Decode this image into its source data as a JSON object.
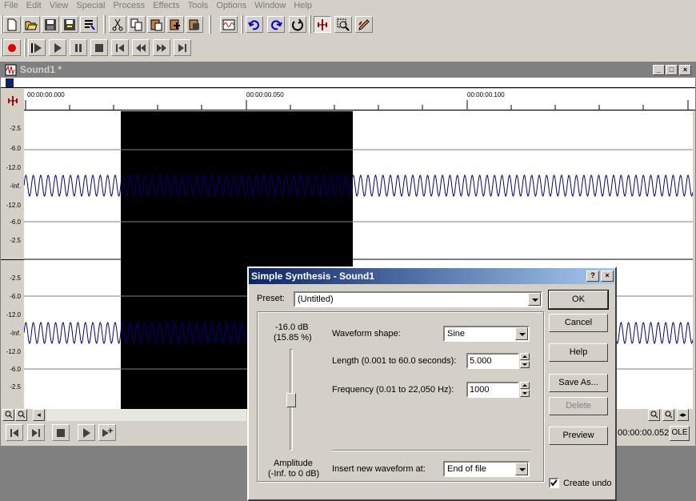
{
  "menu": [
    "File",
    "Edit",
    "View",
    "Special",
    "Process",
    "Effects",
    "Tools",
    "Options",
    "Window",
    "Help"
  ],
  "icons": {
    "toolbar1": [
      "new-icon",
      "open-icon",
      "save-icon",
      "save-as-icon",
      "properties-icon",
      "cut-icon",
      "copy-icon",
      "paste-icon",
      "mix-icon",
      "crop-icon",
      "trim-icon",
      "undo-icon",
      "redo-icon",
      "repeat-icon",
      "edit-tool-icon",
      "magnify-tool-icon",
      "pencil-tool-icon"
    ],
    "transport": [
      "record-icon",
      "play-looped-icon",
      "play-icon",
      "pause-icon",
      "stop-icon",
      "go-to-start-icon",
      "rewind-icon",
      "fast-forward-icon",
      "go-to-end-icon"
    ]
  },
  "sound_window": {
    "title": "Sound1 *",
    "ruler": [
      "00:00:00.000",
      "00:00:00.050",
      "00:00:00.100"
    ],
    "db_labels_ch1": [
      "-2.5",
      "-6.0",
      "-12.0",
      "-Inf.",
      "-12.0",
      "-6.0",
      "-2.5"
    ],
    "db_labels_ch2": [
      "-2.5",
      "-6.0",
      "-12.0",
      "-Inf.",
      "-12.0",
      "-6.0",
      "-2.5"
    ],
    "position": "00:00:00.052",
    "ole_label": "OLE",
    "colors": {
      "wave": "#000080",
      "selection": "#000000",
      "background": "#ffffff"
    }
  },
  "dialog": {
    "title": "Simple Synthesis - Sound1",
    "help_caption": "?",
    "close_caption": "×",
    "preset_label": "Preset:",
    "preset_value": "(Untitled)",
    "amp_db": "-16.0 dB",
    "amp_pct": "(15.85 %)",
    "amp_label1": "Amplitude",
    "amp_label2": "(-Inf. to 0 dB)",
    "amplitude_fraction": 0.5,
    "waveform_label": "Waveform shape:",
    "waveform_value": "Sine",
    "length_label": "Length (0.001 to 60.0 seconds):",
    "length_value": "5.000",
    "frequency_label": "Frequency (0.01 to 22,050 Hz):",
    "frequency_value": "1000",
    "insert_label": "Insert new waveform at:",
    "insert_value": "End of file",
    "ok": "OK",
    "cancel": "Cancel",
    "help": "Help",
    "save_as": "Save As...",
    "delete": "Delete",
    "preview": "Preview",
    "create_undo": "Create undo",
    "create_undo_checked": true
  }
}
